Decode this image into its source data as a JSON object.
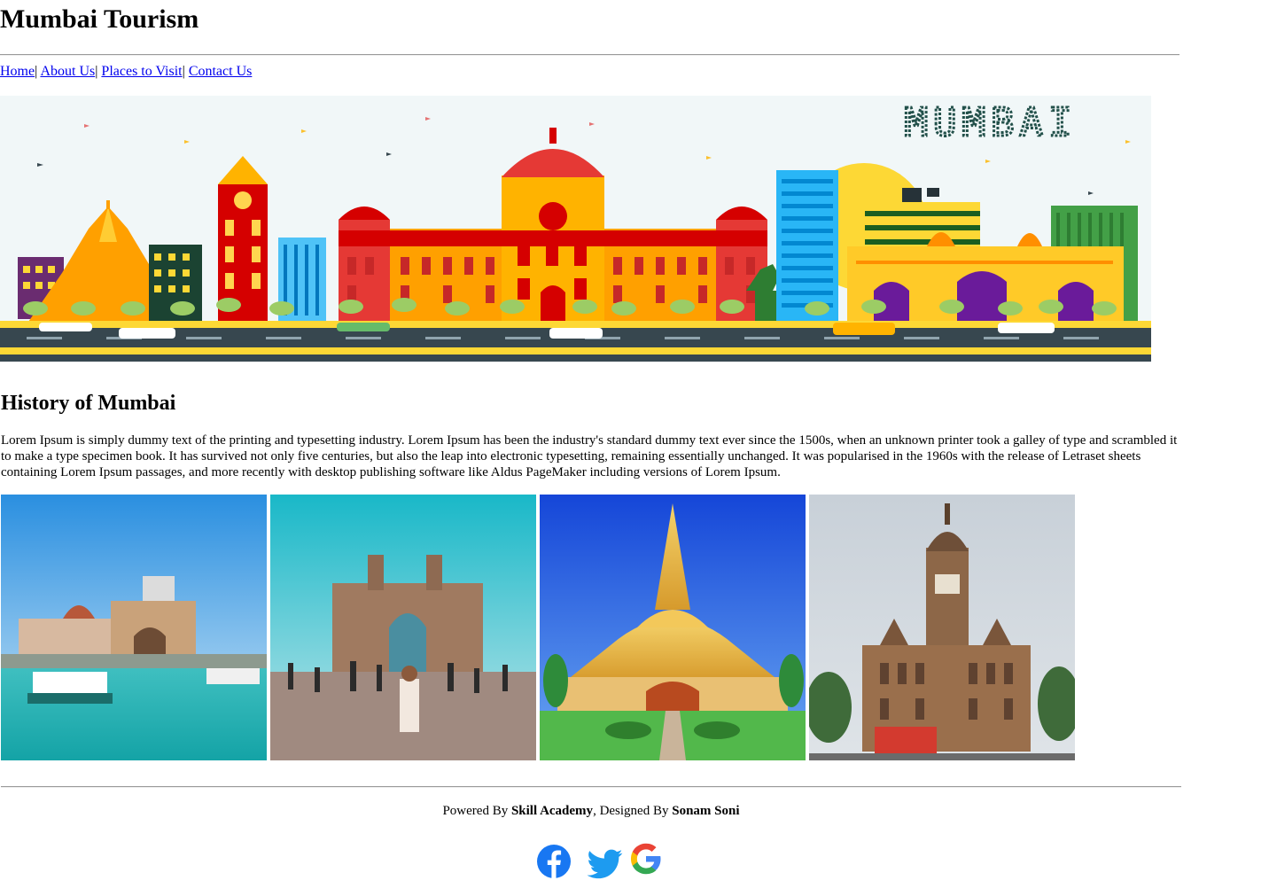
{
  "header": {
    "title": "Mumbai Tourism"
  },
  "nav": {
    "items": [
      {
        "label": "Home"
      },
      {
        "label": "About Us"
      },
      {
        "label": "Places to Visit"
      },
      {
        "label": "Contact Us"
      }
    ],
    "separator": "|"
  },
  "banner": {
    "wordmark": "MUMBAI"
  },
  "history": {
    "heading": "History of Mumbai",
    "text": "Lorem Ipsum is simply dummy text of the printing and typesetting industry. Lorem Ipsum has been the industry's standard dummy text ever since the 1500s, when an unknown printer took a galley of type and scrambled it to make a type specimen book. It has survived not only five centuries, but also the leap into electronic typesetting, remaining essentially unchanged. It was popularised in the 1960s with the release of Letraset sheets containing Lorem Ipsum passages, and more recently with desktop publishing software like Aldus PageMaker including versions of Lorem Ipsum."
  },
  "footer": {
    "powered_prefix": "Powered By ",
    "powered_name": "Skill Academy",
    "designed_prefix": ", Designed By ",
    "designer_name": "Sonam Soni"
  },
  "social": [
    {
      "icon": "facebook-icon",
      "color": "#1877f2"
    },
    {
      "icon": "twitter-icon",
      "color": "#1d9bf0"
    },
    {
      "icon": "google-icon",
      "colors": [
        "#4285f4",
        "#ea4335",
        "#fbbc05",
        "#34a853"
      ]
    }
  ],
  "colors": {
    "link": "#0000ee",
    "rule": "#9a9a9a"
  }
}
